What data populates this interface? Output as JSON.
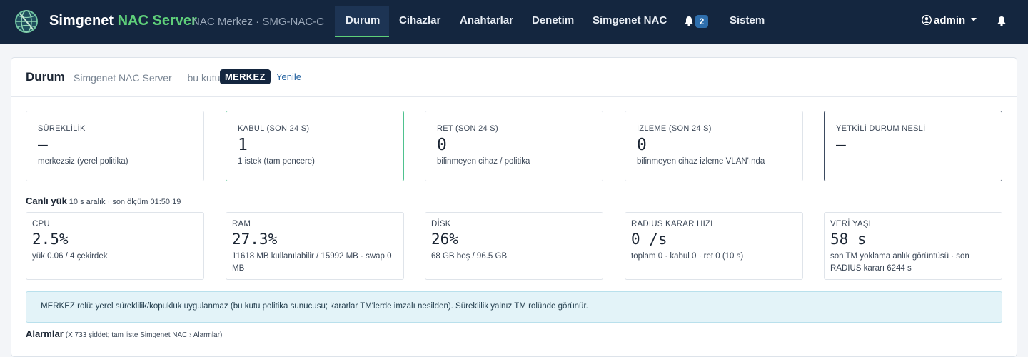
{
  "nav": {
    "brand_main": "Simgenet",
    "brand_accent": "NAC Server",
    "brand_sub": "NAC Merkez · SMG-NAC-C",
    "items": [
      {
        "label": "Durum",
        "active": true
      },
      {
        "label": "Cihazlar"
      },
      {
        "label": "Anahtarlar"
      },
      {
        "label": "Denetim"
      },
      {
        "label": "Simgenet NAC"
      },
      {
        "label": "Sistem"
      }
    ],
    "notification_count": "2",
    "user": "admin",
    "icons": [
      "logo-globe-icon",
      "bell-icon",
      "user-circle-icon",
      "chevron-down-icon"
    ],
    "colors": {
      "navbar": "#14263f",
      "accent": "#5fd07a"
    }
  },
  "card": {
    "title": "Durum",
    "subtitle": "Simgenet NAC Server — bu kutu",
    "role": "MERKEZ",
    "refresh": "Yenile"
  },
  "summary": [
    {
      "label": "SÜREKLİLİK",
      "value": "—",
      "desc": "merkezsiz (yerel politika)"
    },
    {
      "label": "KABUL (SON 24 S)",
      "value": "1",
      "desc": "1 istek (tam pencere)"
    },
    {
      "label": "RET (SON 24 S)",
      "value": "0",
      "desc": "bilinmeyen cihaz / politika"
    },
    {
      "label": "İZLEME (SON 24 S)",
      "value": "0",
      "desc": "bilinmeyen cihaz izleme VLAN'ında"
    },
    {
      "label": "YETKİLİ DURUM NESLİ",
      "value": "—",
      "desc": ""
    }
  ],
  "live": {
    "title": "Canlı yük",
    "meta": "10 s aralık · son ölçüm 01:50:19",
    "metrics": [
      {
        "label": "CPU",
        "value": "2.5%",
        "desc": "yük 0.06 / 4 çekirdek"
      },
      {
        "label": "RAM",
        "value": "27.3%",
        "desc": "11618 MB kullanılabilir / 15992 MB · swap 0 MB"
      },
      {
        "label": "DİSK",
        "value": "26%",
        "desc": "68 GB boş / 96.5 GB"
      },
      {
        "label": "RADIUS KARAR HIZI",
        "value": "0 /s",
        "desc": "toplam 0 · kabul 0 · ret 0 (10 s)"
      },
      {
        "label": "VERİ YAŞI",
        "value": "58 s",
        "desc": "son TM yoklama anlık görüntüsü · son RADIUS kararı 6244 s"
      }
    ]
  },
  "info": "MERKEZ rolü: yerel süreklilik/kopukluk uygulanmaz (bu kutu politika sunucusu; kararlar TM'lerde imzalı nesilden). Süreklilik yalnız TM rolünde görünür.",
  "alarms": {
    "title": "Alarmlar",
    "meta": "(X 733 şiddet; tam liste Simgenet NAC › Alarmlar)"
  }
}
